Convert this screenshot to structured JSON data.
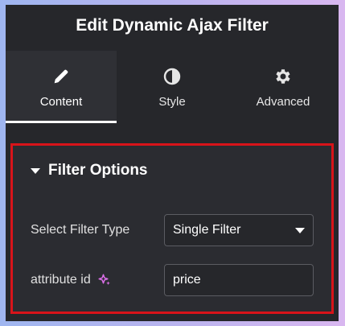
{
  "header": {
    "title": "Edit Dynamic Ajax Filter"
  },
  "tabs": [
    {
      "label": "Content",
      "icon": "pencil-icon",
      "active": true
    },
    {
      "label": "Style",
      "icon": "half-circle-icon",
      "active": false
    },
    {
      "label": "Advanced",
      "icon": "gear-icon",
      "active": false
    }
  ],
  "section": {
    "title": "Filter Options",
    "fields": [
      {
        "label": "Select Filter Type",
        "value": "Single Filter",
        "type": "select"
      },
      {
        "label": "attribute id",
        "value": "price",
        "type": "text",
        "icon": "sparkle-icon"
      }
    ]
  },
  "colors": {
    "highlight_border": "#d8141a",
    "panel_bg": "#26272b",
    "ai_icon": "#d96ee6"
  }
}
